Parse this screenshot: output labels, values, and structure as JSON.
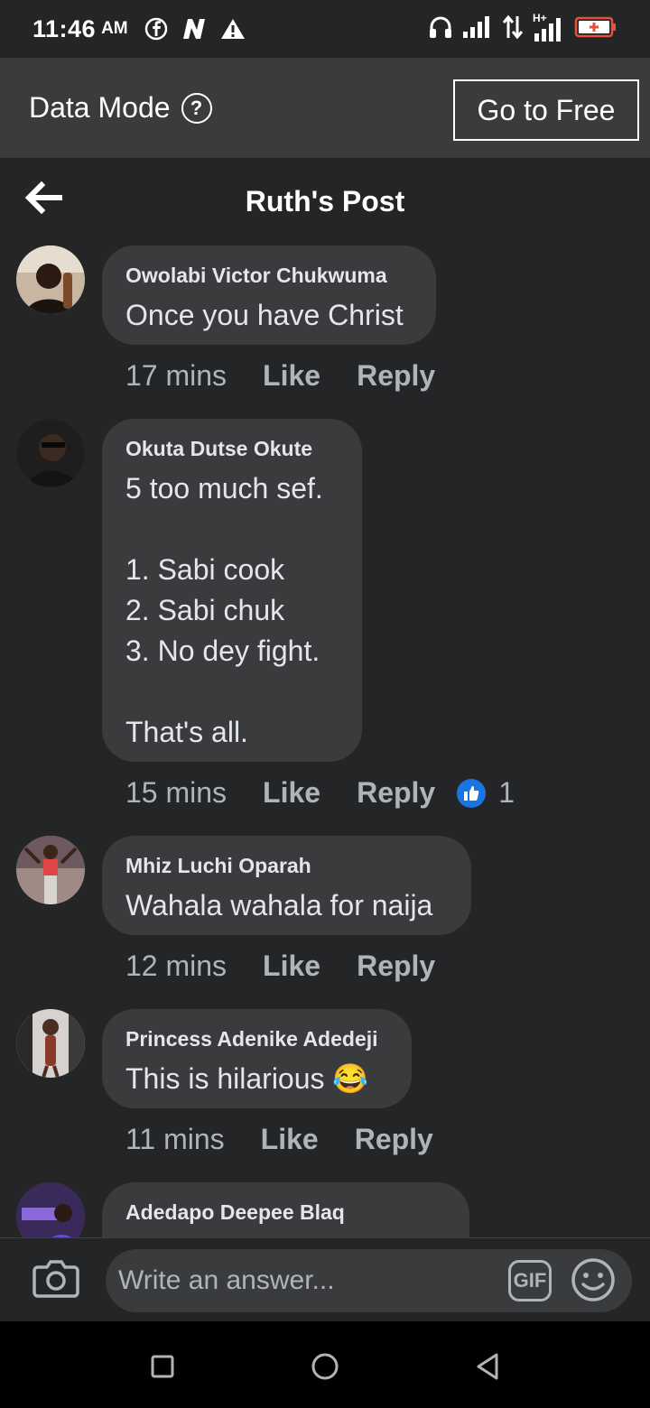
{
  "status_bar": {
    "time": "11:46",
    "ampm": "AM",
    "network_label": "H+"
  },
  "data_mode": {
    "label": "Data Mode",
    "help_symbol": "?",
    "button_label": "Go to Free"
  },
  "header": {
    "title": "Ruth's Post"
  },
  "comments": [
    {
      "author": "Owolabi Victor Chukwuma",
      "text": "Once you have Christ",
      "time": "17 mins",
      "like": "Like",
      "reply": "Reply"
    },
    {
      "author": "Okuta Dutse Okute",
      "text": "5 too much sef.\n\n1. Sabi cook\n2. Sabi chuk\n3. No dey fight.\n\nThat's all.",
      "time": "15 mins",
      "like": "Like",
      "reply": "Reply",
      "reactions": "1"
    },
    {
      "author": "Mhiz Luchi Oparah",
      "text": "Wahala wahala for naija",
      "time": "12 mins",
      "like": "Like",
      "reply": "Reply"
    },
    {
      "author": "Princess Adenike Adedeji",
      "text": "This is hilarious",
      "emoji": "😂",
      "time": "11 mins",
      "like": "Like",
      "reply": "Reply"
    },
    {
      "author": "Adedapo Deepee Blaq"
    }
  ],
  "composer": {
    "placeholder": "Write an answer...",
    "gif_label": "GIF"
  },
  "colors": {
    "background": "#242526",
    "bubble": "#3a3b3c",
    "accent": "#1b74e4"
  }
}
